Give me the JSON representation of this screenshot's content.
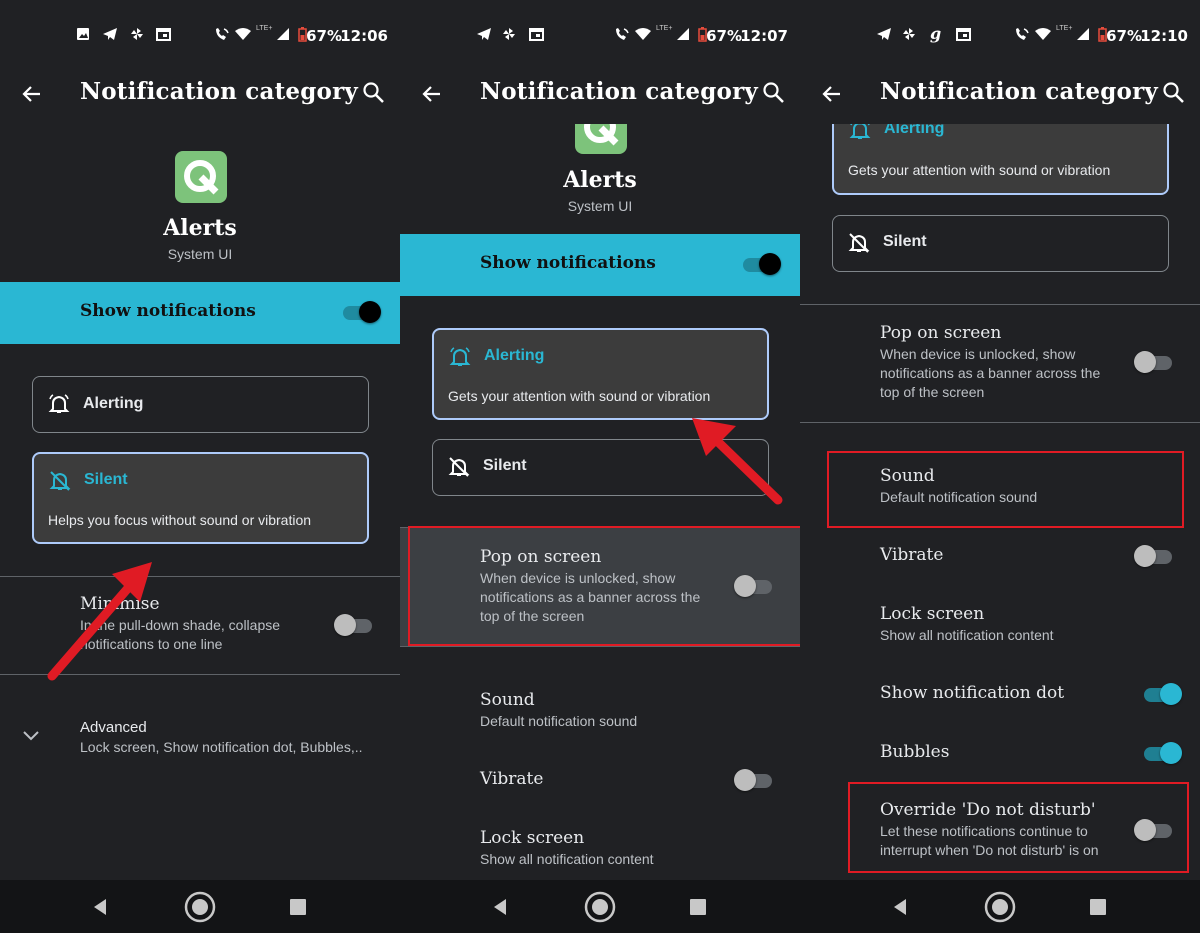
{
  "screens": [
    {
      "status": {
        "time": "12:06",
        "battery": "67%"
      },
      "title": "Notification category",
      "app_name": "Alerts",
      "app_sub": "System UI",
      "show_notifications": "Show notifications",
      "alerting_label": "Alerting",
      "silent_label": "Silent",
      "silent_desc": "Helps you focus without sound or vibration",
      "minimise_title": "Minimise",
      "minimise_desc": "In the pull-down shade, collapse notifications to one line",
      "advanced_title": "Advanced",
      "advanced_desc": "Lock screen, Show notification dot, Bubbles,.."
    },
    {
      "status": {
        "time": "12:07",
        "battery": "67%"
      },
      "title": "Notification category",
      "app_name": "Alerts",
      "app_sub": "System UI",
      "show_notifications": "Show notifications",
      "alerting_label": "Alerting",
      "alerting_desc": "Gets your attention with sound or vibration",
      "silent_label": "Silent",
      "pop_title": "Pop on screen",
      "pop_desc": "When device is unlocked, show notifications as a banner across the top of the screen",
      "sound_title": "Sound",
      "sound_desc": "Default notification sound",
      "vibrate_title": "Vibrate",
      "lock_title": "Lock screen",
      "lock_desc": "Show all notification content"
    },
    {
      "status": {
        "time": "12:10",
        "battery": "67%"
      },
      "title": "Notification category",
      "alerting_label": "Alerting",
      "alerting_desc": "Gets your attention with sound or vibration",
      "silent_label": "Silent",
      "pop_title": "Pop on screen",
      "pop_desc": "When device is unlocked, show notifications as a banner across the top of the screen",
      "sound_title": "Sound",
      "sound_desc": "Default notification sound",
      "vibrate_title": "Vibrate",
      "lock_title": "Lock screen",
      "lock_desc": "Show all notification content",
      "dot_title": "Show notification dot",
      "bubbles_title": "Bubbles",
      "dnd_title": "Override 'Do not disturb'",
      "dnd_desc": "Let these notifications continue to interrupt when 'Do not disturb' is on"
    }
  ],
  "colors": {
    "accent": "#2ab7d3",
    "highlight": "#e01b24",
    "background": "#202124"
  }
}
